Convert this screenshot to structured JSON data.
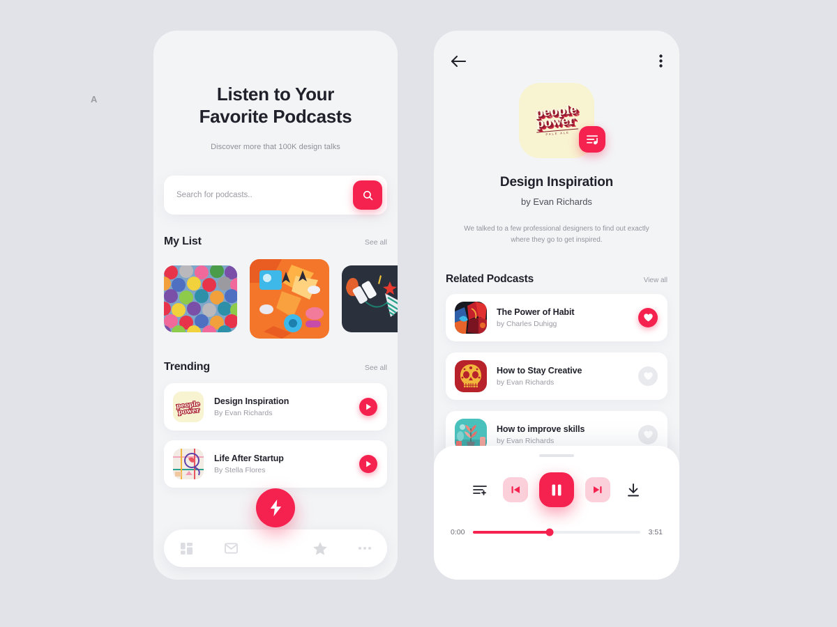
{
  "theme": {
    "accent": "#f5224f",
    "accent_soft": "#fbd0da",
    "canvas_bg": "#e2e3e8",
    "screen_bg": "#f3f4f6",
    "card_bg": "#ffffff",
    "text_dark": "#21212b",
    "text_muted": "#9a9aa4"
  },
  "canvas": {
    "corner_mark": "A"
  },
  "home": {
    "hero": {
      "title_line1": "Listen to Your",
      "title_line2": "Favorite Podcasts",
      "subtitle": "Discover more that 100K design talks"
    },
    "search": {
      "placeholder": "Search for podcasts..",
      "value": "",
      "button_icon": "search-icon"
    },
    "my_list": {
      "title": "My List",
      "see_all": "See all",
      "cards": [
        {
          "name": "colorful-umbrellas-artwork",
          "alt": "Colorful umbrellas grid"
        },
        {
          "name": "orange-3d-isometric-artwork",
          "alt": "Orange isometric 3D scene"
        },
        {
          "name": "dark-navy-illustration-artwork",
          "alt": "Dark navy illustration"
        }
      ]
    },
    "trending": {
      "title": "Trending",
      "see_all": "See all",
      "items": [
        {
          "title": "Design Inspiration",
          "author": "By Evan Richards",
          "thumb": "people-power-cream-thumb",
          "action_icon": "play-icon"
        },
        {
          "title": "Life After Startup",
          "author": "By Stella Flores",
          "thumb": "abstract-lines-thumb",
          "action_icon": "play-icon"
        }
      ]
    },
    "fab": {
      "icon": "lightning-bolt-icon",
      "label": "Quick action"
    },
    "bottom_nav": [
      {
        "icon": "dashboard-grid-icon",
        "label": "Dashboard",
        "active": false
      },
      {
        "icon": "mail-envelope-icon",
        "label": "Inbox",
        "active": false
      },
      {
        "icon": "star-icon",
        "label": "Favorites",
        "active": false
      },
      {
        "icon": "more-dots-icon",
        "label": "More",
        "active": false
      }
    ]
  },
  "detail": {
    "top_bar": {
      "back_icon": "arrow-left-icon",
      "menu_icon": "vertical-dots-icon"
    },
    "artwork": {
      "name": "people-power-album-art",
      "logo_line1": "people",
      "logo_line2": "power",
      "logo_sub": "PALE ALE",
      "badge_icon": "playlist-queue-icon"
    },
    "title": "Design Inspiration",
    "author": "by Evan Richards",
    "description": "We talked to a few professional designers to find out exactly where they go to get inspired.",
    "related": {
      "title": "Related Podcasts",
      "view_all": "View all",
      "items": [
        {
          "title": "The Power of Habit",
          "author": "by Charles Duhigg",
          "thumb": "dark-abstract-art-thumb",
          "liked": true,
          "heart_icon": "heart-icon"
        },
        {
          "title": "How to Stay Creative",
          "author": "by Evan Richards",
          "thumb": "red-sugar-skull-thumb",
          "liked": false,
          "heart_icon": "heart-icon"
        },
        {
          "title": "How to improve skills",
          "author": "by Evan Richards",
          "thumb": "teal-plant-illustration-thumb",
          "liked": false,
          "heart_icon": "heart-icon"
        }
      ]
    },
    "player": {
      "queue_icon": "queue-list-icon",
      "prev_icon": "skip-previous-icon",
      "play_pause_icon": "pause-icon",
      "next_icon": "skip-next-icon",
      "download_icon": "download-icon",
      "elapsed": "0:00",
      "duration": "3:51",
      "progress_percent": 46
    }
  }
}
